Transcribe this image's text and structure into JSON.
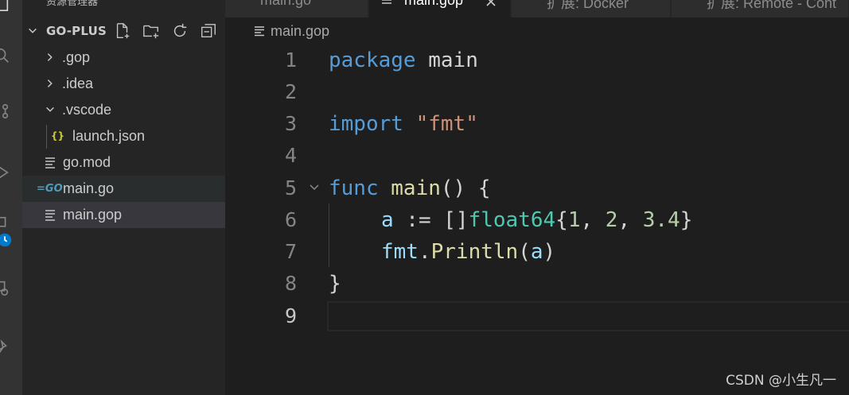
{
  "sidebar": {
    "title": "资源管理器",
    "folder_name": "GO-PLUS",
    "items": [
      {
        "label": ".gop",
        "kind": "folder",
        "expanded": false
      },
      {
        "label": ".idea",
        "kind": "folder",
        "expanded": false
      },
      {
        "label": ".vscode",
        "kind": "folder",
        "expanded": true
      },
      {
        "label": "launch.json",
        "kind": "json"
      },
      {
        "label": "go.mod",
        "kind": "lines"
      },
      {
        "label": "main.go",
        "kind": "go"
      },
      {
        "label": "main.gop",
        "kind": "lines"
      }
    ]
  },
  "tabs": [
    {
      "label": "main.go"
    },
    {
      "label": "main.gop"
    },
    {
      "label": "扩展: Docker"
    },
    {
      "label": "扩展: Remote - Cont"
    }
  ],
  "breadcrumb": {
    "file": "main.gop"
  },
  "editor": {
    "line_numbers": [
      "1",
      "2",
      "3",
      "4",
      "5",
      "6",
      "7",
      "8",
      "9"
    ],
    "lines": {
      "l1": {
        "kw": "package",
        "rest": " main"
      },
      "l3": {
        "kw": "import",
        "str": "\"fmt\""
      },
      "l5": {
        "kw": "func",
        "fn": "main",
        "rest": "() {"
      },
      "l6": {
        "var": "a",
        "op": " := []",
        "type": "float64",
        "open": "{",
        "n1": "1",
        "c1": ", ",
        "n2": "2",
        "c2": ", ",
        "n3": "3.4",
        "close": "}"
      },
      "l7": {
        "pkg": "fmt",
        "dot": ".",
        "fn": "Println",
        "open": "(",
        "arg": "a",
        "close": ")"
      },
      "l8": {
        "text": "}"
      }
    }
  },
  "watermark": "CSDN @小生凡一",
  "colors": {
    "keyword": "#569cd6",
    "string": "#ce9178",
    "function": "#dcdcaa",
    "type": "#4ec9b0",
    "number": "#b5cea8",
    "variable": "#9cdcfe"
  }
}
